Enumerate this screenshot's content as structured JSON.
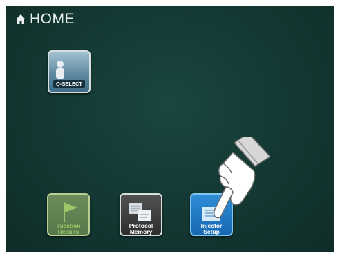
{
  "header": {
    "title": "HOME",
    "icon": "home-icon"
  },
  "tiles": [
    {
      "label": "Q-SELECT",
      "icon": "person-icon"
    },
    {
      "label_line1": "Injection",
      "label_line2": "Results",
      "icon": "flag-icon"
    },
    {
      "label_line1": "Protocol",
      "label_line2": "Memory",
      "icon": "protocol-document-icon"
    },
    {
      "label_line1": "Injector",
      "label_line2": "Setup",
      "icon": "injector-setup-icon"
    }
  ],
  "colors": {
    "background": "#133a36",
    "q_select": "#5f8ba3",
    "injection_results": "#58774a",
    "protocol_memory": "#2e2e2e",
    "injector_setup": "#1768b4"
  }
}
